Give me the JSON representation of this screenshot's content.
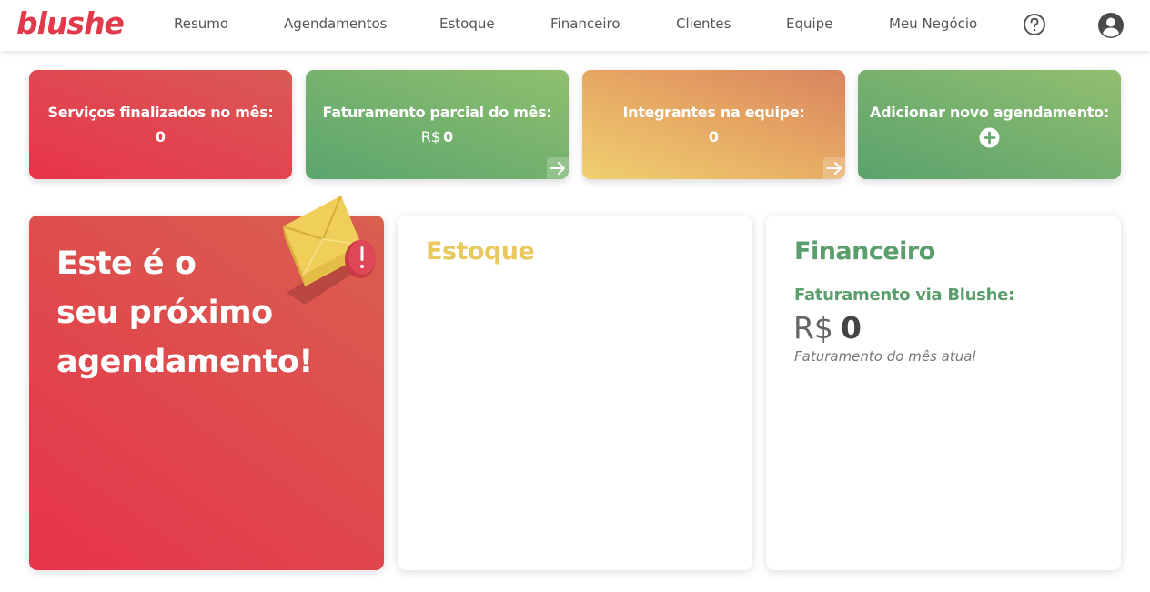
{
  "brand": {
    "logo_text": "blushe",
    "color": "#e23a4b"
  },
  "nav": {
    "items": [
      "Resumo",
      "Agendamentos",
      "Estoque",
      "Financeiro",
      "Clientes",
      "Equipe",
      "Meu Negócio"
    ],
    "help_icon": "help-circle-icon",
    "profile_icon": "user-avatar-icon"
  },
  "stats": [
    {
      "title": "Serviços finalizados no mês:",
      "value": "0",
      "currency": "",
      "icon": ""
    },
    {
      "title": "Faturamento parcial do mês:",
      "value": "0",
      "currency": "R$",
      "icon": "arrow-right-icon"
    },
    {
      "title": "Integrantes na equipe:",
      "value": "0",
      "currency": "",
      "icon": "arrow-right-icon"
    },
    {
      "title": "Adicionar novo agendamento:",
      "value": "",
      "currency": "",
      "icon": "plus-circle-icon"
    }
  ],
  "next_appointment": {
    "line1": "Este é o",
    "line2": "seu próximo",
    "line3": "agendamento!",
    "illustration": "envelope-alert-icon"
  },
  "estoque": {
    "title": "Estoque",
    "color": "#e9c95e"
  },
  "financeiro": {
    "title": "Financeiro",
    "subtitle": "Faturamento via Blushe:",
    "currency": "R$",
    "value": "0",
    "note": "Faturamento do mês atual",
    "color": "#5a9e6b"
  }
}
